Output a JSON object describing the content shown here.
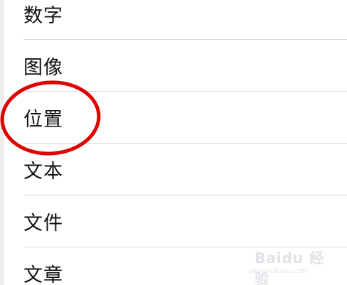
{
  "list": {
    "items": [
      {
        "label": "数字"
      },
      {
        "label": "图像"
      },
      {
        "label": "位置"
      },
      {
        "label": "文本"
      },
      {
        "label": "文件"
      },
      {
        "label": "文章"
      }
    ]
  },
  "annotation": {
    "highlighted_item": "位置",
    "stroke_color": "#e00000"
  },
  "watermark": {
    "brand": "Baidu 经验",
    "url": "jingyan.baidu.com"
  },
  "colors": {
    "background": "#ffffff",
    "divider": "#d9d9de",
    "text": "#111111",
    "side_strip": "#ececf1"
  }
}
